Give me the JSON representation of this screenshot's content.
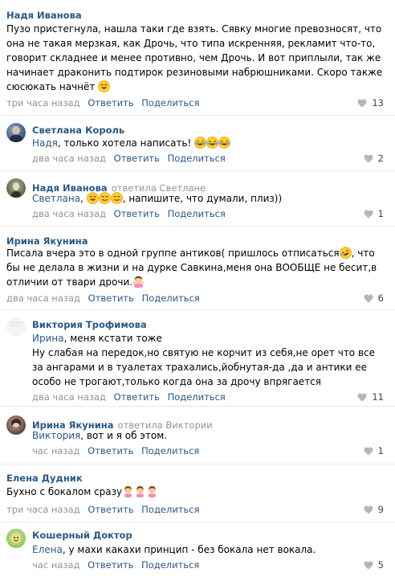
{
  "comments": [
    {
      "author": "Надя Иванова",
      "text": "Пузо пристегнула, нашла таки где взять. Сявку многие превозносят, что она не такая мерзкая, как Дрочь, что типа искренняя, рекламит что-то, говорит складнее и менее противно, чем Дрочь. И вот приплыли, так же начинает драконить подтирок резиновыми набрюшниками. Скоро также сюсюкать начнёт",
      "time": "три часа назад",
      "reply": "Ответить",
      "share": "Поделиться",
      "likes": "13"
    },
    {
      "author": "Светлана Король",
      "mention": "Надя",
      "text": ", только хотела написать!",
      "time": "два часа назад",
      "reply": "Ответить",
      "share": "Поделиться",
      "likes": "2"
    },
    {
      "author": "Надя Иванова",
      "replied_to": "ответила Светлане",
      "mention": "Светлана",
      "text_before": ", ",
      "text": ", напишите, что думали, плиз))",
      "time": "два часа назад",
      "reply": "Ответить",
      "share": "Поделиться",
      "likes": "1"
    },
    {
      "author": "Ирина Якунина",
      "text": "Писала вчера это в одной группе антиков( пришлось отписаться",
      "text2": ", что бы не делала в жизни и на дурке Савкина,меня она ВООБЩЕ не бесит,в отличии от твари дрочи.",
      "time": "два часа назад",
      "reply": "Ответить",
      "share": "Поделиться",
      "likes": "6"
    },
    {
      "author": "Виктория Трофимова",
      "mention": "Ирина",
      "text_first": ", меня кстати тоже",
      "text": "Ну слабая на передок,но святую не корчит из себя,не орет что все за ангарами и в туалетах трахались,йобнутая-да ,да и антики ее особо не трогают,только когда она за дрочу впрягается",
      "time": "два часа назад",
      "reply": "Ответить",
      "share": "Поделиться",
      "likes": "11"
    },
    {
      "author": "Ирина Якунина",
      "replied_to": "ответила Виктории",
      "mention": "Виктория",
      "text": ", вот и я об этом.",
      "time": "час назад",
      "reply": "Ответить",
      "share": "Поделиться",
      "likes": "1"
    },
    {
      "author": "Елена Дудник",
      "text": "Бухно с бокалом сразу",
      "time": "три часа назад",
      "reply": "Ответить",
      "share": "Поделиться",
      "likes": "9"
    },
    {
      "author": "Кошерный Доктор",
      "mention": "Елена",
      "text": ", у махи какахи принцип - без бокала нет вокала.",
      "time": "час назад",
      "reply": "Ответить",
      "share": "Поделиться",
      "likes": "5"
    }
  ],
  "colors": {
    "link": "#2a5885",
    "muted": "#939393",
    "divider": "#e7e8ec"
  },
  "icons": {
    "like": "heart-icon",
    "laugh": "laughing-tears-emoji",
    "smile": "smiling-emoji",
    "rofl": "rofl-emoji",
    "facepalm": "woman-gesturing-emoji",
    "woman": "woman-emoji"
  }
}
